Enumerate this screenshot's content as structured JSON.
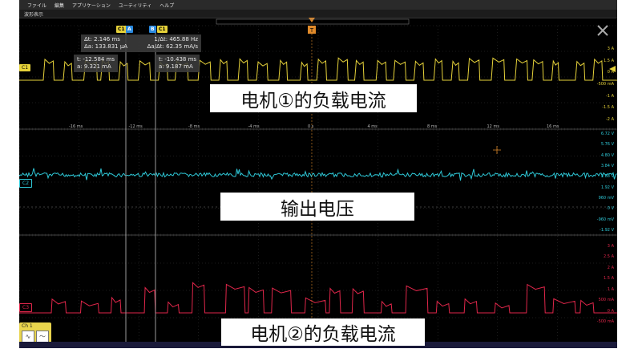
{
  "menu": [
    "ファイル",
    "編集",
    "アプリケーション",
    "ユーティリティ",
    "ヘルプ"
  ],
  "window_title": "波形表示",
  "captions": {
    "top": "电机①的负载电流",
    "middle": "输出电压",
    "bottom": "电机②的负载电流"
  },
  "cursor_tags": {
    "a_ch": "C1",
    "a_name": "A",
    "b_ch": "B",
    "b_name": "C1"
  },
  "measurement_delta": {
    "dt": "Δt: 2.146 ms",
    "inv_dt": "1/Δt: 465.88 Hz",
    "da": "Δa: 133.831 μA",
    "da_dt": "Δa/Δt: 62.35 mA/s"
  },
  "cursor_a_readout": {
    "t": "t: -12.584 ms",
    "a": "a: 9.321 mA"
  },
  "cursor_b_readout": {
    "t": "t: -10.438 ms",
    "a": "a: 9.187 mA"
  },
  "channels": [
    {
      "label": "C1",
      "color": "#e6d23a"
    },
    {
      "label": "C2",
      "color": "#2ec7d6"
    },
    {
      "label": "C3",
      "color": "#e0264a"
    }
  ],
  "trigger_label": "T",
  "ch1_scale": [
    "3 A",
    "1.5 A",
    "0 A",
    "-500 mA",
    "-1 A",
    "-1.5 A",
    "-2 A"
  ],
  "ch2_scale": [
    "6.72 V",
    "5.76 V",
    "4.80 V",
    "3.84 V",
    "2.88 V",
    "1.92 V",
    "960 mV",
    "0 V",
    "-960 mV",
    "-1.92 V"
  ],
  "ch3_scale": [
    "3 A",
    "2.5 A",
    "2 A",
    "1.5 A",
    "1 A",
    "500 mA",
    "0 A",
    "-500 mA"
  ],
  "time_ticks": [
    "-16 ms",
    "-12 ms",
    "-8 ms",
    "-4 ms",
    "0 s",
    "4 ms",
    "8 ms",
    "12 ms",
    "16 ms"
  ],
  "ch1_box_label": "Ch 1",
  "colors": {
    "grid": "#3a3a3a",
    "cursor": "#9a9a9a"
  }
}
